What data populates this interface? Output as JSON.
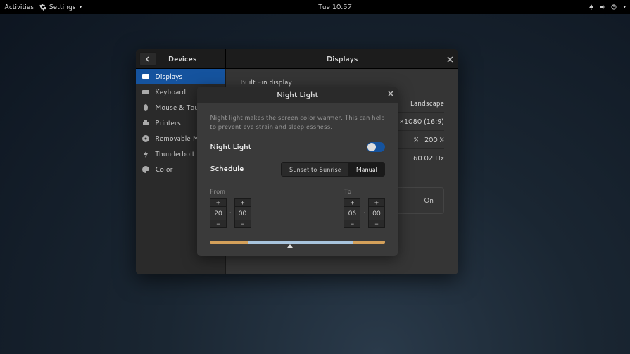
{
  "topbar": {
    "activities": "Activities",
    "app_name": "Settings",
    "clock": "Tue 10:57"
  },
  "window": {
    "left_title": "Devices",
    "right_title": "Displays"
  },
  "sidebar": {
    "items": [
      {
        "icon": "display",
        "label": "Displays"
      },
      {
        "icon": "keyboard",
        "label": "Keyboard"
      },
      {
        "icon": "mouse",
        "label": "Mouse & Touchpad"
      },
      {
        "icon": "printer",
        "label": "Printers"
      },
      {
        "icon": "media",
        "label": "Removable Media"
      },
      {
        "icon": "thunderbolt",
        "label": "Thunderbolt"
      },
      {
        "icon": "color",
        "label": "Color"
      }
    ]
  },
  "content": {
    "display_name": "Built -in display",
    "rows": {
      "orientation": "Landscape",
      "resolution": "×1080 (16:9)",
      "scale_pct": "%",
      "scale_200": "200 %",
      "refresh": "60.02 Hz"
    },
    "nightlight_btn": "On"
  },
  "modal": {
    "title": "Night Light",
    "description": "Night light makes the screen color warmer. This can help to prevent eye strain and sleeplessness.",
    "toggle_label": "Night Light",
    "schedule_label": "Schedule",
    "seg": {
      "sunset": "Sunset to Sunrise",
      "manual": "Manual"
    },
    "from_label": "From",
    "to_label": "To",
    "from": {
      "hh": "20",
      "mm": "00"
    },
    "to": {
      "hh": "06",
      "mm": "00"
    },
    "plus": "+",
    "minus": "−",
    "colon": ":"
  }
}
